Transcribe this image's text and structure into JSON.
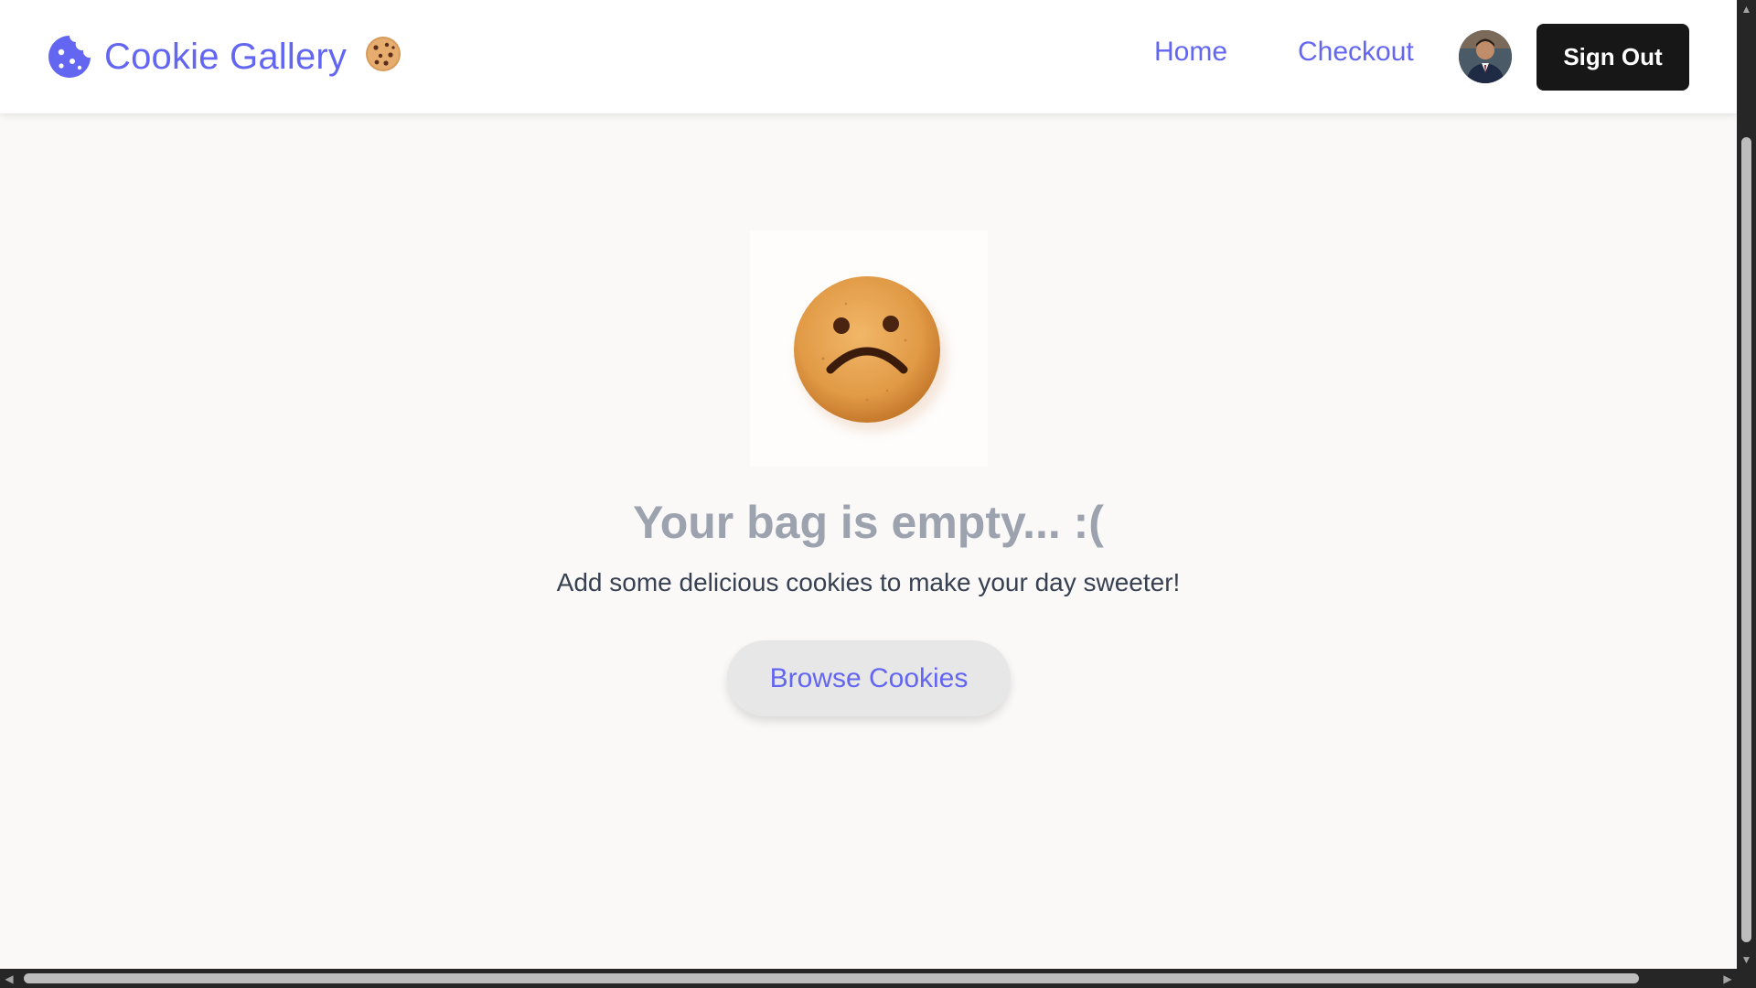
{
  "header": {
    "brand_title": "Cookie Gallery",
    "brand_icon": "cookie-icon",
    "brand_emoji": "🍪",
    "nav": [
      {
        "label": "Home"
      },
      {
        "label": "Checkout"
      }
    ],
    "avatar": "user-avatar",
    "signout_label": "Sign Out"
  },
  "main": {
    "illustration": "sad-cookie-image",
    "title": "Your bag is empty... :(",
    "subtitle": "Add some delicious cookies to make your day sweeter!",
    "browse_label": "Browse Cookies"
  },
  "colors": {
    "accent": "#6366f1",
    "signout_bg": "#171717",
    "title_gray": "#9ca3af",
    "page_bg": "#faf9f8"
  }
}
